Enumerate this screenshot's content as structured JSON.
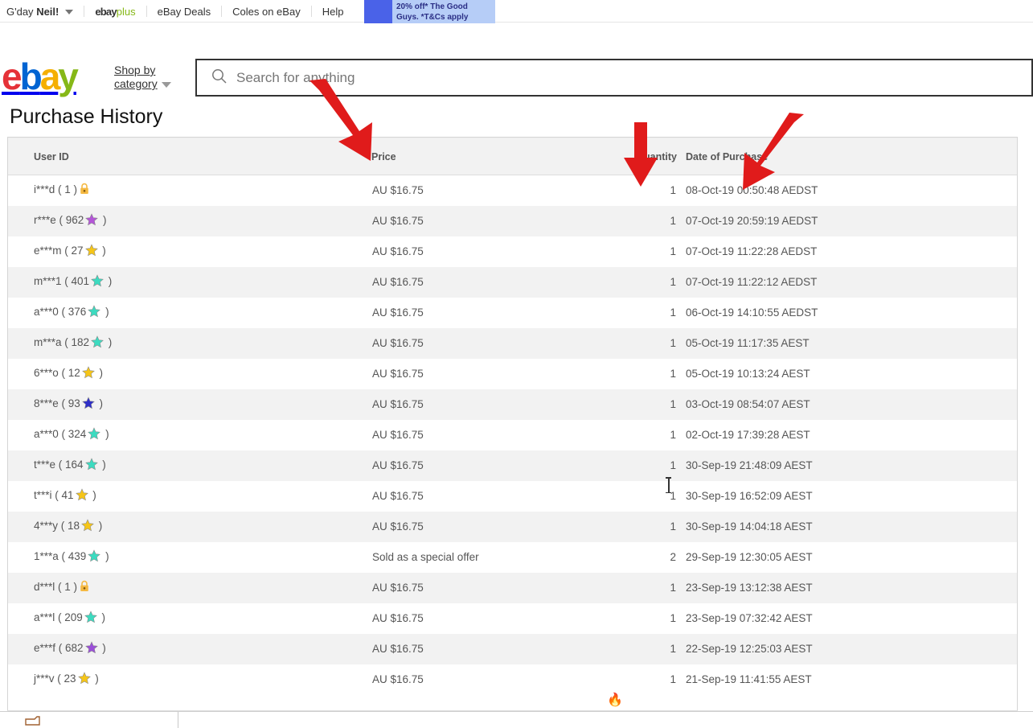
{
  "topbar": {
    "greeting_prefix": "G'day",
    "greeting_name": "Neil!",
    "links": [
      {
        "label": "ebay",
        "sublabel": "plus",
        "name": "ebay-plus"
      },
      {
        "label": "eBay Deals",
        "name": "ebay-deals"
      },
      {
        "label": "Coles on eBay",
        "name": "coles-on-ebay"
      },
      {
        "label": "Help",
        "name": "help"
      }
    ],
    "promo": {
      "line1": "20% off* The Good",
      "line2": "Guys. *T&Cs apply",
      "bg_color": "#b6cdf7",
      "accent_color": "#4a62e8",
      "text_color": "#2b2f86"
    }
  },
  "header": {
    "logo": {
      "e": "e",
      "b": "b",
      "a": "a",
      "y": "y",
      "color_e": "#e53238",
      "color_b": "#0064d2",
      "color_a": "#f5af02",
      "color_y": "#86b817"
    },
    "shop_by_line1": "Shop by",
    "shop_by_line2": "category",
    "search": {
      "placeholder": "Search for anything",
      "value": ""
    }
  },
  "page": {
    "title": "Purchase History"
  },
  "table": {
    "columns": [
      {
        "key": "user",
        "label": "User ID"
      },
      {
        "key": "price",
        "label": "Price"
      },
      {
        "key": "qty",
        "label": "Quantity"
      },
      {
        "key": "date",
        "label": "Date of Purchase"
      }
    ],
    "rows": [
      {
        "user": "i***d ( 1 )",
        "badge": "lock",
        "badge_color": "#f5b942",
        "price": "AU $16.75",
        "qty": "1",
        "date": "08-Oct-19 00:50:48 AEDST"
      },
      {
        "user": "r***e ( 962",
        "badge": "star",
        "badge_color": "#b455d8",
        "user_suffix": ")",
        "price": "AU $16.75",
        "qty": "1",
        "date": "07-Oct-19 20:59:19 AEDST"
      },
      {
        "user": "e***m ( 27",
        "badge": "star",
        "badge_color": "#f5c518",
        "user_suffix": ")",
        "price": "AU $16.75",
        "qty": "1",
        "date": "07-Oct-19 11:22:28 AEDST"
      },
      {
        "user": "m***1 ( 401",
        "badge": "star",
        "badge_color": "#3cdbc0",
        "user_suffix": ")",
        "price": "AU $16.75",
        "qty": "1",
        "date": "07-Oct-19 11:22:12 AEDST"
      },
      {
        "user": "a***0 ( 376",
        "badge": "star",
        "badge_color": "#3cdbc0",
        "user_suffix": ")",
        "price": "AU $16.75",
        "qty": "1",
        "date": "06-Oct-19 14:10:55 AEDST"
      },
      {
        "user": "m***a ( 182",
        "badge": "star",
        "badge_color": "#3cdbc0",
        "user_suffix": ")",
        "price": "AU $16.75",
        "qty": "1",
        "date": "05-Oct-19 11:17:35 AEST"
      },
      {
        "user": "6***o ( 12",
        "badge": "star",
        "badge_color": "#f5c518",
        "user_suffix": ")",
        "price": "AU $16.75",
        "qty": "1",
        "date": "05-Oct-19 10:13:24 AEST"
      },
      {
        "user": "8***e ( 93",
        "badge": "star",
        "badge_color": "#2f2fc8",
        "user_suffix": ")",
        "price": "AU $16.75",
        "qty": "1",
        "date": "03-Oct-19 08:54:07 AEST"
      },
      {
        "user": "a***0 ( 324",
        "badge": "star",
        "badge_color": "#3cdbc0",
        "user_suffix": ")",
        "price": "AU $16.75",
        "qty": "1",
        "date": "02-Oct-19 17:39:28 AEST"
      },
      {
        "user": "t***e ( 164",
        "badge": "star",
        "badge_color": "#3cdbc0",
        "user_suffix": ")",
        "price": "AU $16.75",
        "qty": "1",
        "date": "30-Sep-19 21:48:09 AEST"
      },
      {
        "user": "t***i ( 41",
        "badge": "star",
        "badge_color": "#f5c518",
        "user_suffix": ")",
        "price": "AU $16.75",
        "qty": "1",
        "date": "30-Sep-19 16:52:09 AEST"
      },
      {
        "user": "4***y ( 18",
        "badge": "star",
        "badge_color": "#f5c518",
        "user_suffix": ")",
        "price": "AU $16.75",
        "qty": "1",
        "date": "30-Sep-19 14:04:18 AEST"
      },
      {
        "user": "1***a ( 439",
        "badge": "star",
        "badge_color": "#3cdbc0",
        "user_suffix": ")",
        "price": "Sold as a special offer",
        "qty": "2",
        "date": "29-Sep-19 12:30:05 AEST"
      },
      {
        "user": "d***l ( 1 )",
        "badge": "lock",
        "badge_color": "#f5b942",
        "price": "AU $16.75",
        "qty": "1",
        "date": "23-Sep-19 13:12:38 AEST"
      },
      {
        "user": "a***l ( 209",
        "badge": "star",
        "badge_color": "#3cdbc0",
        "user_suffix": ")",
        "price": "AU $16.75",
        "qty": "1",
        "date": "23-Sep-19 07:32:42 AEST"
      },
      {
        "user": "e***f ( 682",
        "badge": "star",
        "badge_color": "#9b4fd8",
        "user_suffix": ")",
        "price": "AU $16.75",
        "qty": "1",
        "date": "22-Sep-19 12:25:03 AEST"
      },
      {
        "user": "j***v ( 23",
        "badge": "star",
        "badge_color": "#f5c518",
        "user_suffix": ")",
        "price": "AU $16.75",
        "qty": "1",
        "date": "21-Sep-19 11:41:55 AEST"
      }
    ]
  },
  "annotations": {
    "color": "#e01b1b",
    "arrows": [
      {
        "name": "arrow-pointing-to-price-column",
        "direction": "down-right"
      },
      {
        "name": "arrow-pointing-to-quantity-column",
        "direction": "down"
      },
      {
        "name": "arrow-pointing-to-date-column",
        "direction": "down-left"
      }
    ]
  }
}
